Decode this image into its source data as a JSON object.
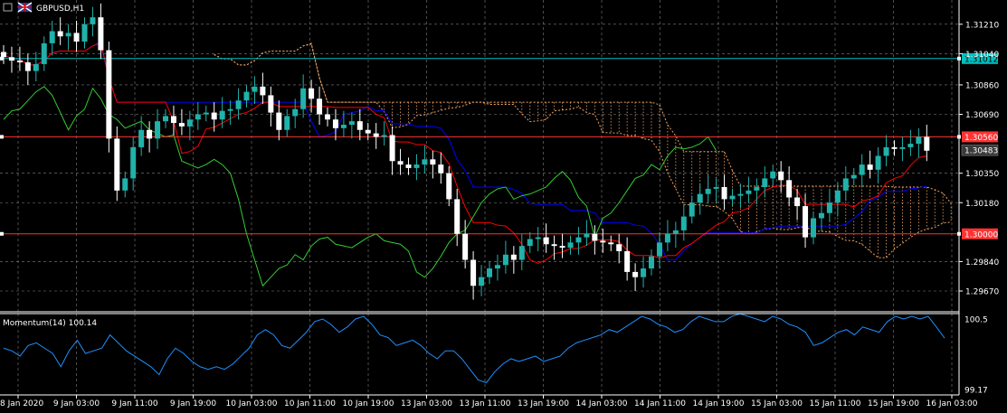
{
  "header": {
    "symbol": "GBPUSD,H1"
  },
  "colors": {
    "background": "#000000",
    "grid": "#808080",
    "axis": "#ffffff",
    "bull": "#20b2aa",
    "bear": "#ffffff",
    "tenkan": "#ff0000",
    "kijun": "#0000ff",
    "chikou": "#32cd32",
    "cloud": "#f4a460",
    "momentum": "#1e90ff",
    "hline_cyan": "#00bfbf",
    "hline_red": "#ff3333"
  },
  "chart_data": [
    {
      "type": "candlestick",
      "title": "GBPUSD,H1",
      "ylim": [
        1.2955,
        1.3135
      ],
      "yticks": [
        "1.31210",
        "1.31040",
        "1.30860",
        "1.30690",
        "1.30350",
        "1.30180",
        "1.29840",
        "1.29670"
      ],
      "xticks": [
        "8 Jan 2020",
        "9 Jan 03:00",
        "9 Jan 11:00",
        "9 Jan 19:00",
        "10 Jan 03:00",
        "10 Jan 11:00",
        "10 Jan 19:00",
        "13 Jan 03:00",
        "13 Jan 11:00",
        "13 Jan 19:00",
        "14 Jan 03:00",
        "14 Jan 11:00",
        "14 Jan 19:00",
        "15 Jan 03:00",
        "15 Jan 11:00",
        "15 Jan 19:00",
        "16 Jan 03:00"
      ],
      "hlines": [
        {
          "value": 1.31012,
          "label": "1.31012",
          "color": "cyan"
        },
        {
          "value": 1.3056,
          "label": "1.30560",
          "color": "red"
        },
        {
          "value": 1.3,
          "label": "1.30000",
          "color": "red"
        }
      ],
      "last_price": {
        "value": 1.30483,
        "label": "1.30483"
      },
      "closes": [
        1.3102,
        1.31,
        1.3099,
        1.3094,
        1.3098,
        1.311,
        1.3117,
        1.3114,
        1.3116,
        1.3111,
        1.3121,
        1.3125,
        1.3106,
        1.3055,
        1.3025,
        1.3032,
        1.305,
        1.306,
        1.3055,
        1.3065,
        1.3068,
        1.3064,
        1.3062,
        1.3066,
        1.3069,
        1.307,
        1.3066,
        1.3071,
        1.3072,
        1.3077,
        1.3082,
        1.3085,
        1.308,
        1.307,
        1.306,
        1.3068,
        1.3072,
        1.3084,
        1.3078,
        1.3069,
        1.3066,
        1.3061,
        1.3063,
        1.3065,
        1.306,
        1.3058,
        1.3056,
        1.3057,
        1.3042,
        1.304,
        1.3038,
        1.304,
        1.3043,
        1.304,
        1.3035,
        1.302,
        1.3,
        1.2985,
        1.297,
        1.2975,
        1.298,
        1.2982,
        1.2988,
        1.2985,
        1.2993,
        1.2997,
        1.2998,
        1.2994,
        1.2993,
        1.2992,
        1.2995,
        1.2998,
        1.3,
        1.2996,
        1.2995,
        1.2994,
        1.299,
        1.2978,
        1.2975,
        1.298,
        1.2987,
        1.2995,
        1.3,
        1.3002,
        1.301,
        1.3018,
        1.3023,
        1.3026,
        1.3027,
        1.302,
        1.3022,
        1.3023,
        1.3025,
        1.3027,
        1.3032,
        1.3036,
        1.3031,
        1.3021,
        1.3016,
        1.2998,
        1.3009,
        1.3012,
        1.3018,
        1.3025,
        1.3032,
        1.3034,
        1.304,
        1.3037,
        1.3045,
        1.305,
        1.3049,
        1.305,
        1.3052,
        1.3056,
        1.3048
      ],
      "indicators": [
        "Tenkan-sen",
        "Kijun-sen",
        "Chikou Span",
        "Kumo"
      ]
    },
    {
      "type": "line",
      "title": "Momentum(14) 100.14",
      "ylim": [
        99.17,
        100.5
      ],
      "yticks": [
        "100.5",
        "99.17"
      ],
      "values": [
        99.95,
        99.9,
        99.8,
        100.0,
        100.05,
        99.95,
        99.85,
        99.6,
        99.9,
        100.1,
        99.85,
        99.9,
        99.95,
        100.2,
        100.05,
        99.9,
        99.8,
        99.7,
        99.6,
        99.45,
        99.75,
        99.95,
        99.85,
        99.7,
        99.6,
        99.55,
        99.6,
        99.55,
        99.65,
        99.8,
        99.95,
        100.2,
        100.3,
        100.2,
        100.0,
        99.95,
        100.1,
        100.25,
        100.45,
        100.5,
        100.4,
        100.25,
        100.35,
        100.5,
        100.55,
        100.4,
        100.2,
        100.15,
        100.0,
        100.05,
        100.1,
        100.0,
        99.85,
        99.75,
        99.9,
        99.9,
        99.75,
        99.55,
        99.35,
        99.3,
        99.5,
        99.65,
        99.75,
        99.7,
        99.75,
        99.8,
        99.7,
        99.75,
        99.8,
        99.95,
        100.05,
        100.1,
        100.15,
        100.2,
        100.3,
        100.25,
        100.35,
        100.45,
        100.55,
        100.5,
        100.4,
        100.35,
        100.25,
        100.3,
        100.45,
        100.55,
        100.5,
        100.45,
        100.45,
        100.55,
        100.6,
        100.55,
        100.5,
        100.45,
        100.55,
        100.5,
        100.4,
        100.35,
        100.25,
        100.0,
        100.05,
        100.15,
        100.25,
        100.3,
        100.2,
        100.35,
        100.3,
        100.25,
        100.45,
        100.55,
        100.5,
        100.55,
        100.5,
        100.55,
        100.35,
        100.14
      ]
    }
  ]
}
